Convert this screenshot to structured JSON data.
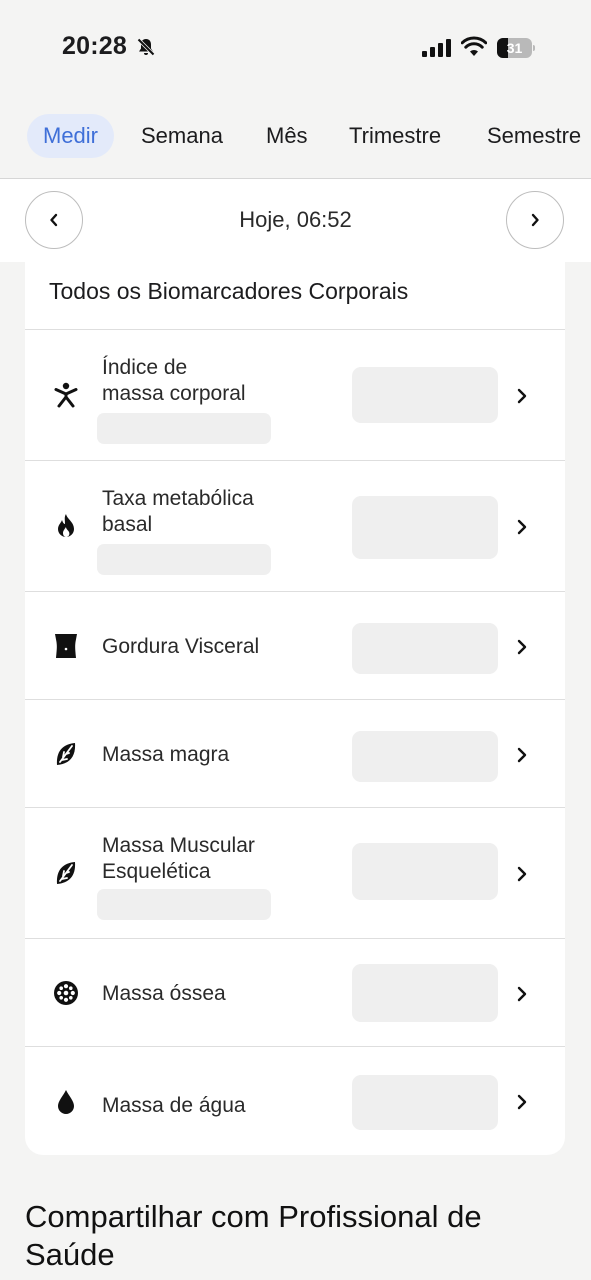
{
  "status_bar": {
    "time": "20:28",
    "battery": "31",
    "battery_level": 0.31
  },
  "tabs": [
    {
      "label": "Medir",
      "active": true
    },
    {
      "label": "Semana",
      "active": false
    },
    {
      "label": "Mês",
      "active": false
    },
    {
      "label": "Trimestre",
      "active": false
    },
    {
      "label": "Semestre",
      "active": false
    }
  ],
  "date_nav": {
    "label": "Hoje, 06:52"
  },
  "card": {
    "title": "Todos os Biomarcadores Corporais",
    "rows": [
      {
        "label": "Índice de\nmassa corporal",
        "icon": "person-icon"
      },
      {
        "label": "Taxa metabólica\nbasal",
        "icon": "flame-icon"
      },
      {
        "label": "Gordura Visceral",
        "icon": "waist-icon"
      },
      {
        "label": "Massa magra",
        "icon": "leaf-icon"
      },
      {
        "label": "Massa Muscular\nEsquelética",
        "icon": "leaf-icon"
      },
      {
        "label": "Massa óssea",
        "icon": "bone-density-icon"
      },
      {
        "label": "Massa de água",
        "icon": "water-drop-icon"
      }
    ]
  },
  "share": {
    "title": "Compartilhar com Profissional de Saúde"
  },
  "colors": {
    "accent": "#3f6fd8",
    "tab_active_bg": "#e3eafa",
    "placeholder": "#efefef"
  }
}
